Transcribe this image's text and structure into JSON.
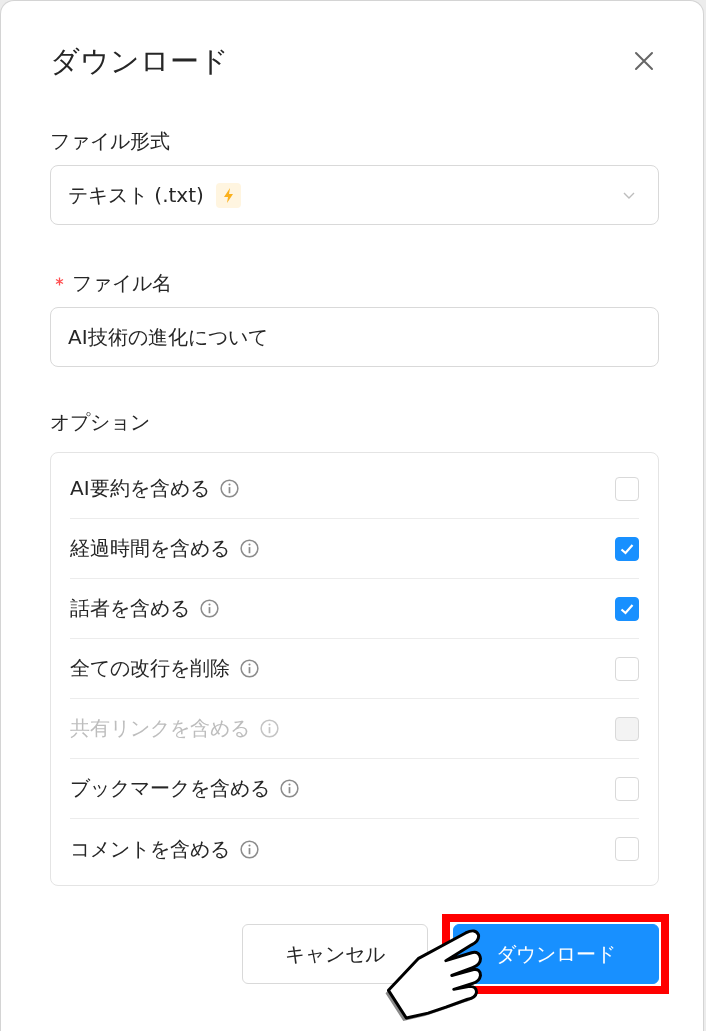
{
  "dialog": {
    "title": "ダウンロード"
  },
  "file_format": {
    "label": "ファイル形式",
    "value": "テキスト (.txt)"
  },
  "file_name": {
    "label": "ファイル名",
    "required": true,
    "value": "AI技術の進化について"
  },
  "options": {
    "label": "オプション",
    "items": [
      {
        "label": "AI要約を含める",
        "checked": false,
        "disabled": false
      },
      {
        "label": "経過時間を含める",
        "checked": true,
        "disabled": false
      },
      {
        "label": "話者を含める",
        "checked": true,
        "disabled": false
      },
      {
        "label": "全ての改行を削除",
        "checked": false,
        "disabled": false
      },
      {
        "label": "共有リンクを含める",
        "checked": false,
        "disabled": true
      },
      {
        "label": "ブックマークを含める",
        "checked": false,
        "disabled": false
      },
      {
        "label": "コメントを含める",
        "checked": false,
        "disabled": false
      }
    ]
  },
  "buttons": [
    {
      "label": "キャンセル",
      "kind": "secondary",
      "highlighted": false,
      "pointed": false
    },
    {
      "label": "ダウンロード",
      "kind": "primary",
      "highlighted": true,
      "pointed": true
    }
  ]
}
